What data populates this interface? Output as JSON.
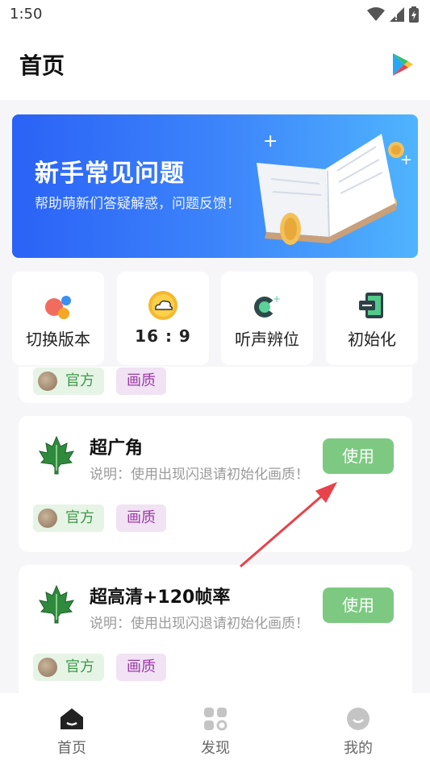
{
  "status_bar": {
    "time": "1:50"
  },
  "header": {
    "title": "首页",
    "play_icon": "play-store-icon"
  },
  "banner": {
    "title": "新手常见问题",
    "subtitle": "帮助萌新们答疑解惑，问题反馈！"
  },
  "quick_actions": [
    {
      "label": "切换版本",
      "icon": "switch-version-icon"
    },
    {
      "label": "16 : 9",
      "icon": "cloud-icon"
    },
    {
      "label": "听声辨位",
      "icon": "audio-locate-icon"
    },
    {
      "label": "初始化",
      "icon": "reset-icon"
    }
  ],
  "cards": [
    {
      "title": "",
      "desc": "",
      "tag_official": "官方",
      "tag_quality": "画质"
    },
    {
      "title": "超广角",
      "desc": "说明：使用出现闪退请初始化画质！",
      "button": "使用",
      "tag_official": "官方",
      "tag_quality": "画质"
    },
    {
      "title": "超高清+120帧率",
      "desc": "说明：使用出现闪退请初始化画质！",
      "button": "使用",
      "tag_official": "官方",
      "tag_quality": "画质"
    }
  ],
  "tabbar": [
    {
      "label": "首页",
      "icon": "home-icon",
      "active": true
    },
    {
      "label": "发现",
      "icon": "discover-icon",
      "active": false
    },
    {
      "label": "我的",
      "icon": "profile-icon",
      "active": false
    }
  ],
  "colors": {
    "banner_start": "#2a62f6",
    "banner_end": "#4fb4fd",
    "use_button": "#7dc982",
    "arrow": "#e8424a"
  }
}
